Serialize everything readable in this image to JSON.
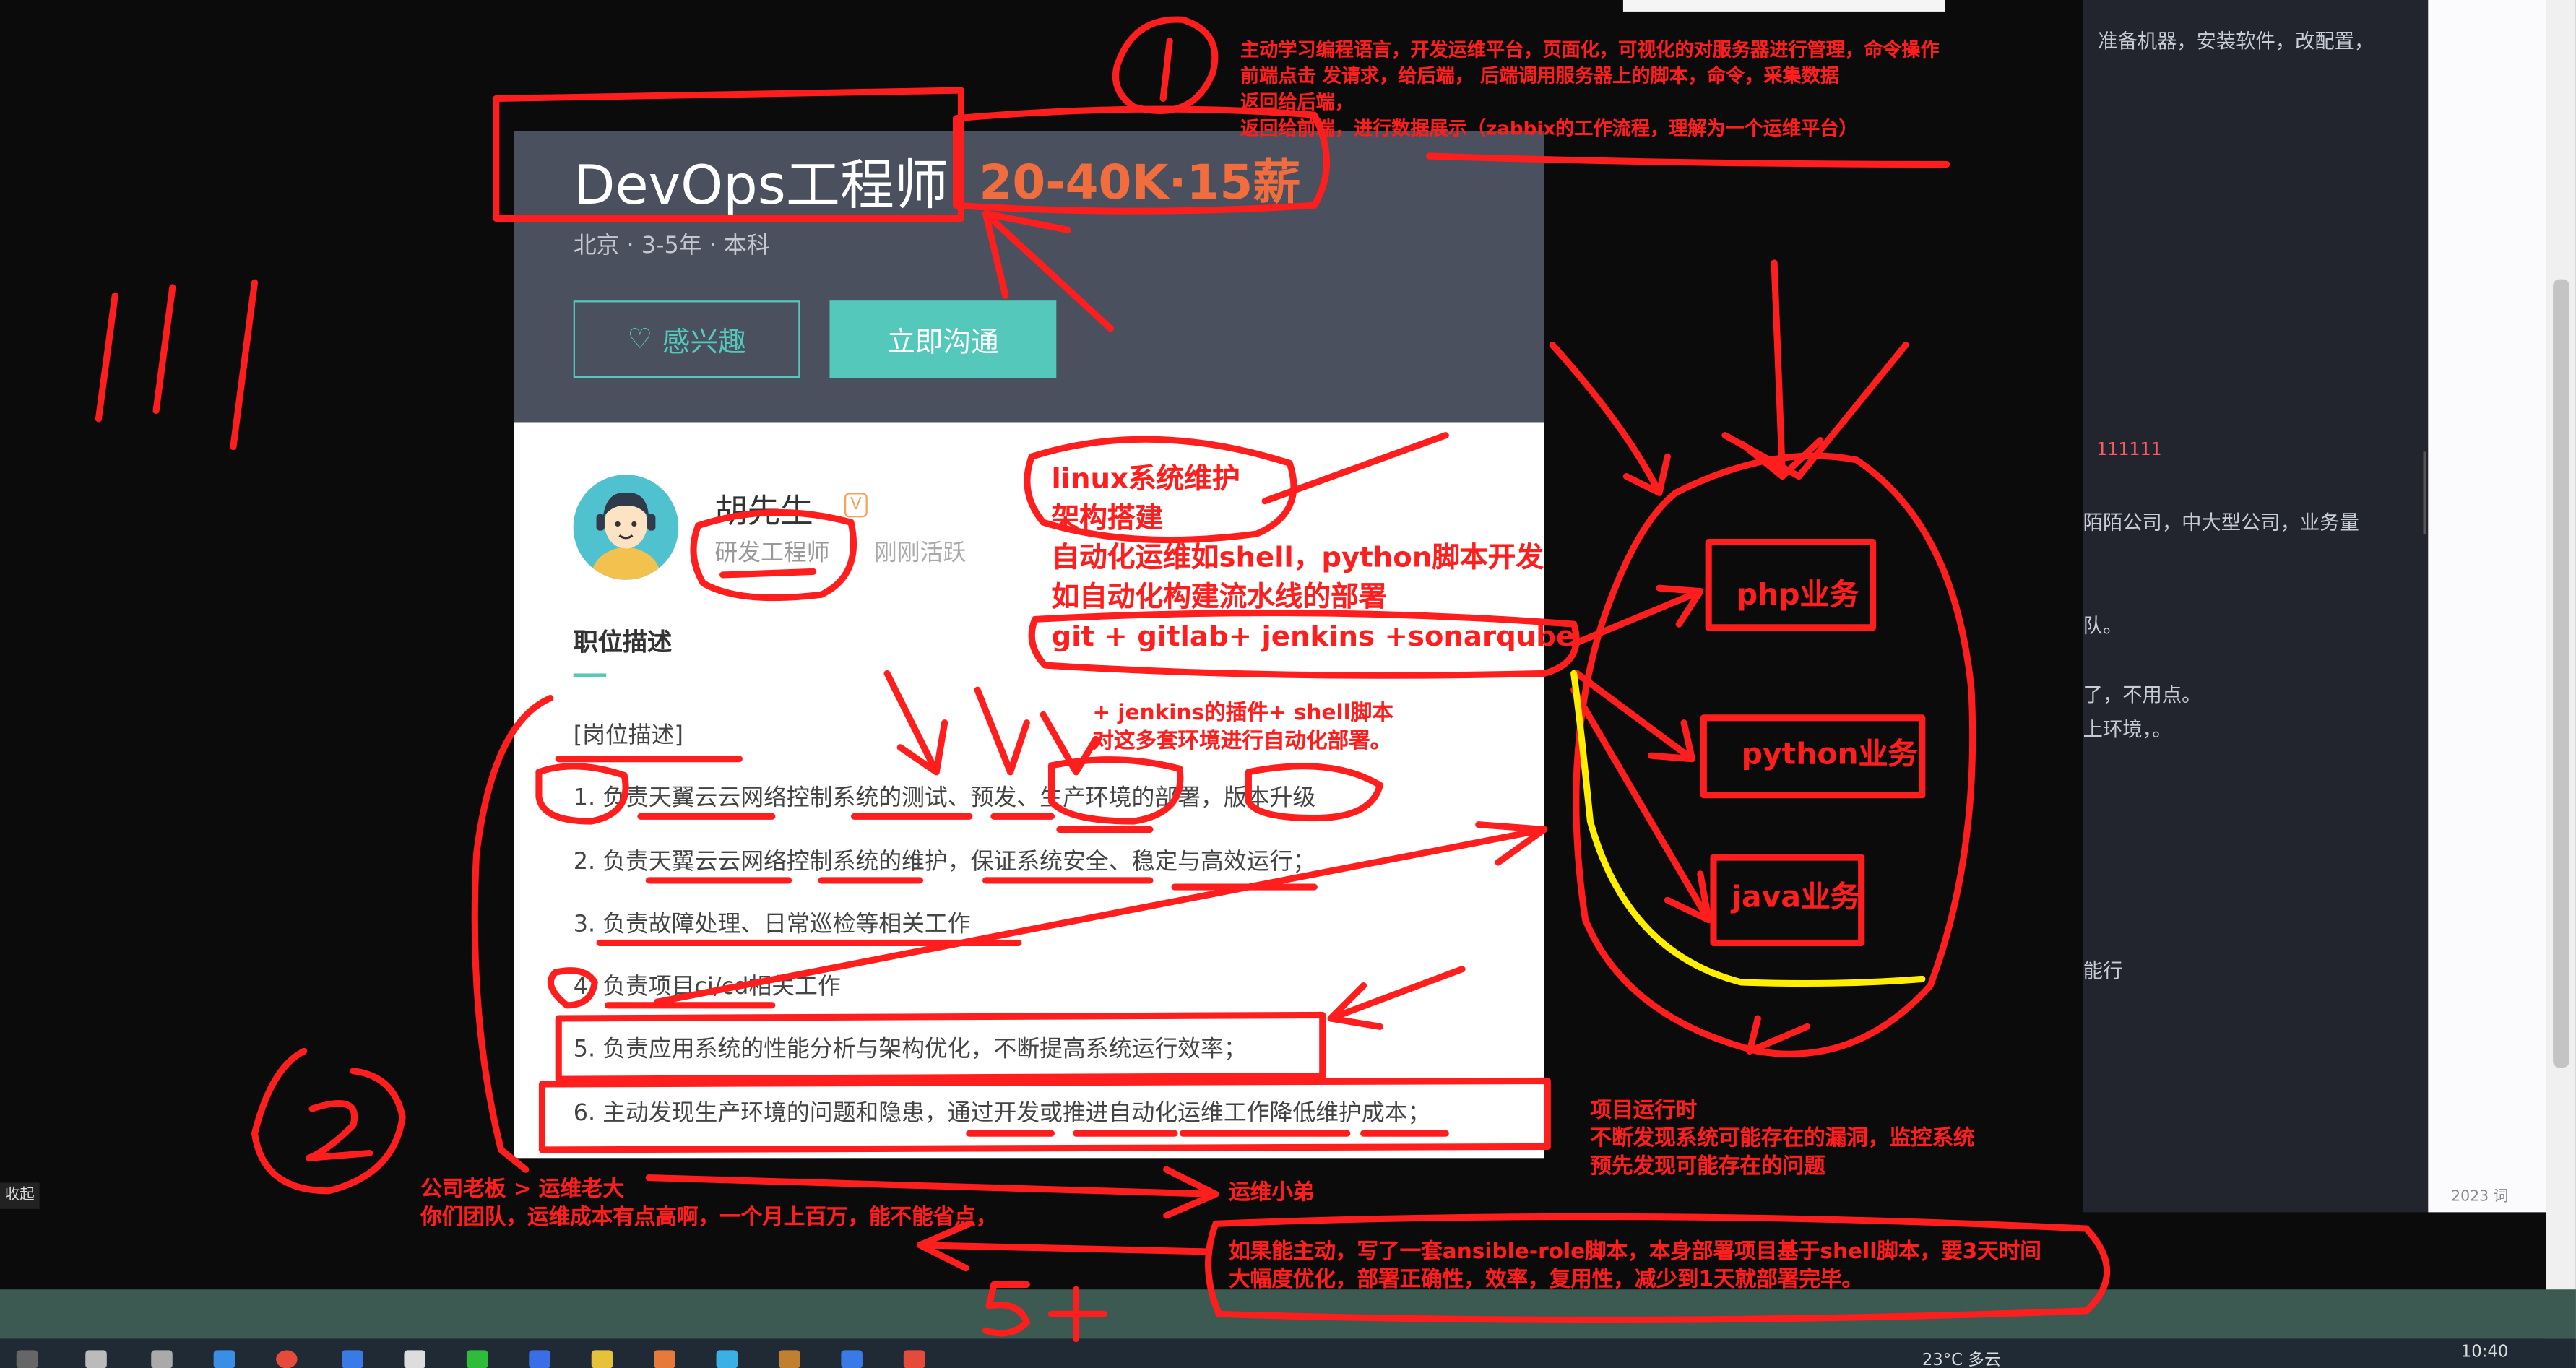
{
  "job": {
    "title": "DevOps工程师",
    "salary": "20-40K·15薪",
    "meta": "北京 · 3-5年 · 本科",
    "btn_interest": "感兴趣",
    "btn_chat": "立即沟通",
    "recruiter_name": "胡先生",
    "recruiter_verified_mark": "V",
    "recruiter_role": "研发工程师",
    "recruiter_status": "刚刚活跃",
    "desc_heading": "职位描述",
    "desc_lines": [
      "[岗位描述]",
      "1. 负责天翼云云网络控制系统的测试、预发、生产环境的部署，版本升级",
      "2. 负责天翼云云网络控制系统的维护，保证系统安全、稳定与高效运行；",
      "3. 负责故障处理、日常巡检等相关工作",
      "4. 负责项目ci/cd相关工作",
      "5. 负责应用系统的性能分析与架构优化，不断提高系统运行效率；",
      "6. 主动发现生产环境的问题和隐患，通过开发或推进自动化运维工作降低维护成本；"
    ]
  },
  "editor": {
    "lines": [
      "准备机器，安装软件，改配置，",
      "111111",
      "陌陌公司，中大型公司，业务量",
      "队。",
      "了，不用点。",
      "上环境，。",
      "能行"
    ],
    "word_count": "2023 词"
  },
  "collapse_label": "收起",
  "taskbar": {
    "weather": "23°C 多云",
    "time": "10:40"
  },
  "annotations": {
    "top_note": [
      "主动学习编程语言，开发运维平台，页面化，可视化的对服务器进行管理，命令操作",
      "前端点击 发请求，给后端， 后端调用服务器上的脚本，命令，采集数据",
      "返回给后端，",
      "返回给前端，进行数据展示（zabbix的工作流程，理解为一个运维平台）"
    ],
    "circle_one": "1",
    "circle_two": "2",
    "left_marks": "111",
    "skills": [
      "linux系统维护",
      "架构搭建",
      "自动化运维如shell，python脚本开发",
      "如自动化构建流水线的部署",
      "git + gitlab+  jenkins  +sonarqube"
    ],
    "jenkins_note": [
      "+ jenkins的插件+ shell脚本",
      "对这多套环境进行自动化部署。"
    ],
    "business_boxes": [
      "php业务",
      "python业务",
      "java业务"
    ],
    "runtime_note": [
      "项目运行时",
      "不断发现系统可能存在的漏洞，监控系统",
      "预先发现可能存在的问题"
    ],
    "boss_note": [
      "公司老板 >  运维老大",
      "你们团队，运维成本有点高啊，一个月上百万，能不能省点，"
    ],
    "junior_label": "运维小弟",
    "ansible_note": [
      "如果能主动，写了一套ansible-role脚本，本身部署项目基于shell脚本，要3天时间",
      "大幅度优化，部署正确性，效率，复用性，减少到1天就部署完毕。"
    ],
    "five_plus": "5+"
  },
  "colors": {
    "ink_red": "#ff1e1e",
    "highlight_yellow": "#ffee00",
    "accent_teal": "#54c8bb",
    "salary_orange": "#f26d3d",
    "header_bg": "#4b505e"
  }
}
